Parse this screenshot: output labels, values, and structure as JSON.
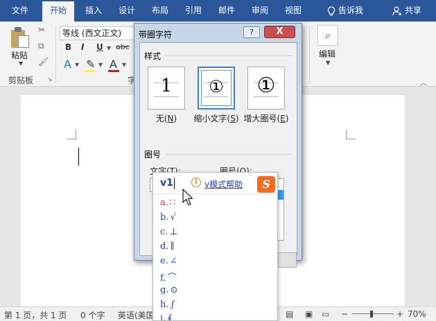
{
  "tabs": [
    {
      "label": "文件",
      "active": false
    },
    {
      "label": "开始",
      "active": true
    },
    {
      "label": "插入",
      "active": false
    },
    {
      "label": "设计",
      "active": false
    },
    {
      "label": "布局",
      "active": false
    },
    {
      "label": "引用",
      "active": false
    },
    {
      "label": "邮件",
      "active": false
    },
    {
      "label": "审阅",
      "active": false
    },
    {
      "label": "视图",
      "active": false
    }
  ],
  "tell_me": {
    "label": "告诉我",
    "icon": "lightbulb-icon"
  },
  "share": {
    "label": "共享",
    "icon": "person-add-icon"
  },
  "ribbon": {
    "paste_label": "粘贴",
    "clipboard_label": "剪贴板",
    "font_name": "等线 (西文正文)",
    "bold": "B",
    "italic": "I",
    "underline": "U",
    "strike": "abc",
    "font_color_letter": "A",
    "edit_label": "编辑",
    "font_group_label_fragment": "字"
  },
  "dialog": {
    "title": "带圈字符",
    "help": "?",
    "close": "X",
    "style_section": "样式",
    "styles": [
      {
        "glyph": "1",
        "label_pre": "无(",
        "key": "N",
        "label_post": ")",
        "selected": false
      },
      {
        "glyph": "①",
        "label_pre": "缩小文字(",
        "key": "S",
        "label_post": ")",
        "selected": true
      },
      {
        "glyph": "①",
        "label_pre": "增大圈号(",
        "key": "E",
        "label_post": ")",
        "selected": false
      }
    ],
    "circle_section": "圈号",
    "text_label_pre": "文字(",
    "text_key": "T",
    "text_label_post": "):",
    "circle_label_pre": "圈号(",
    "circle_key": "O",
    "circle_label_post": "):",
    "circle_list": [
      "○",
      ""
    ]
  },
  "ime": {
    "input": "v1",
    "info_icon": "i",
    "help": "v模式帮助",
    "logo": "S",
    "candidates": [
      {
        "letter": "a.",
        "symbol": "∷"
      },
      {
        "letter": "b.",
        "symbol": "√"
      },
      {
        "letter": "c.",
        "symbol": "⊥"
      },
      {
        "letter": "d.",
        "symbol": "∥"
      },
      {
        "letter": "e.",
        "symbol": "∠"
      },
      {
        "letter": "f.",
        "symbol": "⌒"
      },
      {
        "letter": "g.",
        "symbol": "⊙"
      },
      {
        "letter": "h.",
        "symbol": "∫"
      },
      {
        "letter": "i.",
        "symbol": "∮"
      }
    ]
  },
  "status": {
    "page": "第 1 页，共 1 页",
    "words": "0 个字",
    "language": "英语(美国",
    "zoom": "70%",
    "zoom_minus": "−",
    "zoom_plus": "+"
  }
}
